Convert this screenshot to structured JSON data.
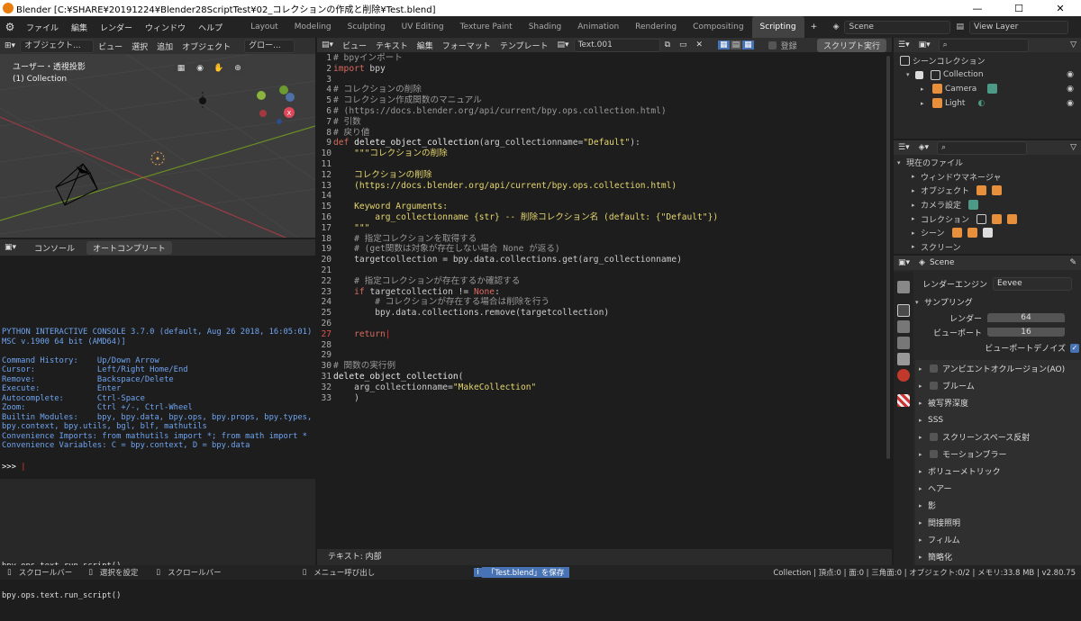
{
  "window": {
    "title": "Blender [C:¥SHARE¥20191224¥Blender28ScriptTest¥02_コレクションの作成と削除¥Test.blend]",
    "min": "—",
    "max": "☐",
    "close": "✕"
  },
  "menu": [
    "ファイル",
    "編集",
    "レンダー",
    "ウィンドウ",
    "ヘルプ"
  ],
  "workspaces": [
    "Layout",
    "Modeling",
    "Sculpting",
    "UV Editing",
    "Texture Paint",
    "Shading",
    "Animation",
    "Rendering",
    "Compositing",
    "Scripting"
  ],
  "workspace_add": "+",
  "scene": "Scene",
  "view_layer": "View Layer",
  "viewport": {
    "mode": "オブジェクト...",
    "menu": [
      "ビュー",
      "選択",
      "追加",
      "オブジェクト"
    ],
    "orient": "グロー...",
    "title": "ユーザー・透視投影",
    "collection": "(1) Collection"
  },
  "console": {
    "tabs": [
      "コンソール",
      "オートコンプリート"
    ],
    "lines": [
      "PYTHON INTERACTIVE CONSOLE 3.7.0 (default, Aug 26 2018, 16:05:01) [",
      "MSC v.1900 64 bit (AMD64)]",
      "",
      "Command History:    Up/Down Arrow",
      "Cursor:             Left/Right Home/End",
      "Remove:             Backspace/Delete",
      "Execute:            Enter",
      "Autocomplete:       Ctrl-Space",
      "Zoom:               Ctrl +/-, Ctrl-Wheel",
      "Builtin Modules:    bpy, bpy.data, bpy.ops, bpy.props, bpy.types,",
      "bpy.context, bpy.utils, bgl, blf, mathutils",
      "Convenience Imports: from mathutils import *; from math import *",
      "Convenience Variables: C = bpy.context, D = bpy.data"
    ],
    "prompt": ">>> ",
    "info_lines": [
      "bpy.ops.text.run_script()",
      "bpy.ops.text.run_script()"
    ]
  },
  "text_editor": {
    "menu": [
      "ビュー",
      "テキスト",
      "編集",
      "フォーマット",
      "テンプレート"
    ],
    "filename": "Text.001",
    "register_label": "登録",
    "run_button": "スクリプト実行",
    "footer": "テキスト: 内部",
    "code": [
      "# bpyインポート",
      "import bpy",
      "",
      "# コレクションの削除",
      "# コレクション作成関数のマニュアル",
      "# (https://docs.blender.org/api/current/bpy.ops.collection.html)",
      "# 引数",
      "# 戻り値",
      "def delete_object_collection(arg_collectionname=\"Default\"):",
      "    \"\"\"コレクションの削除",
      "",
      "    コレクションの削除",
      "    (https://docs.blender.org/api/current/bpy.ops.collection.html)",
      "",
      "    Keyword Arguments:",
      "        arg_collectionname {str} -- 削除コレクション名 (default: {\"Default\"})",
      "    \"\"\"",
      "    # 指定コレクションを取得する",
      "    # (get関数は対象が存在しない場合 None が返る)",
      "    targetcollection = bpy.data.collections.get(arg_collectionname)",
      "",
      "    # 指定コレクションが存在するか確認する",
      "    if targetcollection != None:",
      "        # コレクションが存在する場合は削除を行う",
      "        bpy.data.collections.remove(targetcollection)",
      "",
      "    return",
      "",
      "",
      "# 関数の実行例",
      "delete_object_collection(",
      "    arg_collectionname=\"MakeCollection\"",
      "    )"
    ]
  },
  "outliner": {
    "root": "シーンコレクション",
    "items": [
      "Collection",
      "Camera",
      "Light"
    ]
  },
  "file_browser": {
    "root": "現在のファイル",
    "items": [
      "ウィンドウマネージャ",
      "オブジェクト",
      "カメラ設定",
      "コレクション",
      "シーン",
      "スクリーン"
    ]
  },
  "properties": {
    "scene": "Scene",
    "render_engine_label": "レンダーエンジン",
    "render_engine": "Eevee",
    "sampling": "サンプリング",
    "render_label": "レンダー",
    "render_value": "64",
    "viewport_label": "ビューポート",
    "viewport_value": "16",
    "denoise": "ビューポートデノイズ",
    "panels": [
      "アンビエントオクルージョン(AO)",
      "ブルーム",
      "被写界深度",
      "SSS",
      "スクリーンスペース反射",
      "モーションブラー",
      "ボリューメトリック",
      "ヘアー",
      "影",
      "間接照明",
      "フィルム",
      "簡略化"
    ]
  },
  "status": {
    "items": [
      "スクロールバー",
      "選択を設定",
      "スクロールバー",
      "メニュー呼び出し"
    ],
    "saved": "「Test.blend」を保存",
    "stats": "Collection | 頂点:0 | 面:0 | 三角面:0 | オブジェクト:0/2 | メモリ:33.8 MB | v2.80.75"
  },
  "colors": {
    "accent": "#4772b3",
    "keyword": "#d96a5f",
    "string": "#e6d66e",
    "comment": "#999999",
    "func": "#e6d66e",
    "console_text": "#6fa4f0"
  }
}
